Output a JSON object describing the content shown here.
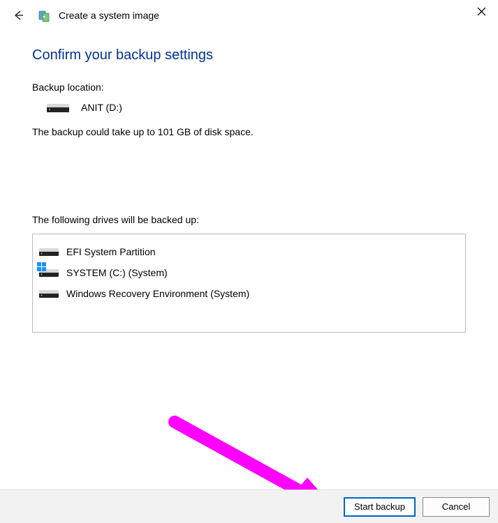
{
  "window": {
    "title": "Create a system image"
  },
  "heading": "Confirm your backup settings",
  "backup_location_label": "Backup location:",
  "backup_location_value": "ANIT (D:)",
  "space_info": "The backup could take up to 101 GB of disk space.",
  "drives_label": "The following drives will be backed up:",
  "drives": [
    {
      "name": "EFI System Partition",
      "overlay": "none"
    },
    {
      "name": "SYSTEM (C:) (System)",
      "overlay": "windows"
    },
    {
      "name": "Windows Recovery Environment (System)",
      "overlay": "none"
    }
  ],
  "buttons": {
    "start": "Start backup",
    "cancel": "Cancel"
  }
}
